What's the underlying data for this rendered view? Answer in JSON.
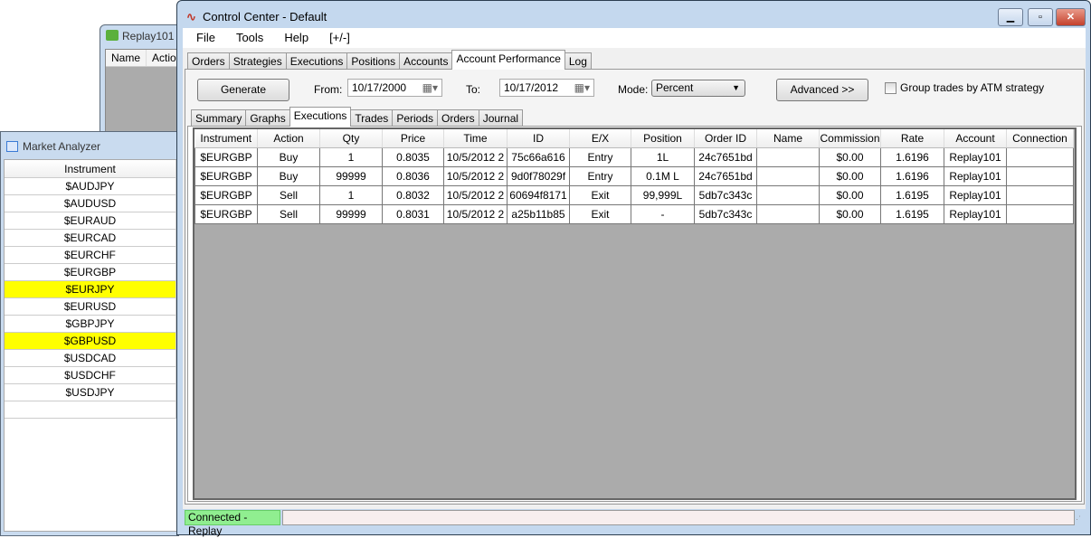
{
  "replay_window": {
    "title": "Replay101",
    "columns": [
      "Name",
      "Action"
    ]
  },
  "market_analyzer": {
    "title": "Market Analyzer",
    "column": "Instrument",
    "rows": [
      {
        "name": "$AUDJPY",
        "highlight": false
      },
      {
        "name": "$AUDUSD",
        "highlight": false
      },
      {
        "name": "$EURAUD",
        "highlight": false
      },
      {
        "name": "$EURCAD",
        "highlight": false
      },
      {
        "name": "$EURCHF",
        "highlight": false
      },
      {
        "name": "$EURGBP",
        "highlight": false
      },
      {
        "name": "$EURJPY",
        "highlight": true
      },
      {
        "name": "$EURUSD",
        "highlight": false
      },
      {
        "name": "$GBPJPY",
        "highlight": false
      },
      {
        "name": "$GBPUSD",
        "highlight": true
      },
      {
        "name": "$USDCAD",
        "highlight": false
      },
      {
        "name": "$USDCHF",
        "highlight": false
      },
      {
        "name": "$USDJPY",
        "highlight": false
      },
      {
        "name": "",
        "highlight": false
      }
    ]
  },
  "control_center": {
    "title": "Control Center - Default",
    "menu": [
      "File",
      "Tools",
      "Help",
      "[+/-]"
    ],
    "tabs": [
      "Orders",
      "Strategies",
      "Executions",
      "Positions",
      "Accounts",
      "Account Performance",
      "Log"
    ],
    "active_tab": "Account Performance",
    "generate": "Generate",
    "from_label": "From:",
    "from_value": "10/17/2000",
    "to_label": "To:",
    "to_value": "10/17/2012",
    "mode_label": "Mode:",
    "mode_value": "Percent",
    "advanced": "Advanced >>",
    "group_label": "Group trades by ATM strategy",
    "group_checked": false,
    "subtabs": [
      "Summary",
      "Graphs",
      "Executions",
      "Trades",
      "Periods",
      "Orders",
      "Journal"
    ],
    "active_subtab": "Executions",
    "columns": [
      "Instrument",
      "Action",
      "Qty",
      "Price",
      "Time",
      "ID",
      "E/X",
      "Position",
      "Order ID",
      "Name",
      "Commission",
      "Rate",
      "Account",
      "Connection"
    ],
    "rows": [
      [
        "$EURGBP",
        "Buy",
        "1",
        "0.8035",
        "10/5/2012 2",
        "75c66a616",
        "Entry",
        "1L",
        "24c7651bd",
        "",
        "$0.00",
        "1.6196",
        "Replay101",
        ""
      ],
      [
        "$EURGBP",
        "Buy",
        "99999",
        "0.8036",
        "10/5/2012 2",
        "9d0f78029f",
        "Entry",
        "0.1M L",
        "24c7651bd",
        "",
        "$0.00",
        "1.6196",
        "Replay101",
        ""
      ],
      [
        "$EURGBP",
        "Sell",
        "1",
        "0.8032",
        "10/5/2012 2",
        "60694f8171",
        "Exit",
        "99,999L",
        "5db7c343c",
        "",
        "$0.00",
        "1.6195",
        "Replay101",
        ""
      ],
      [
        "$EURGBP",
        "Sell",
        "99999",
        "0.8031",
        "10/5/2012 2",
        "a25b11b85",
        "Exit",
        "-",
        "5db7c343c",
        "",
        "$0.00",
        "1.6195",
        "Replay101",
        ""
      ]
    ],
    "status": "Connected - Replay"
  },
  "colors": {
    "highlight": "#ffff00",
    "status_green": "#90ee90"
  }
}
